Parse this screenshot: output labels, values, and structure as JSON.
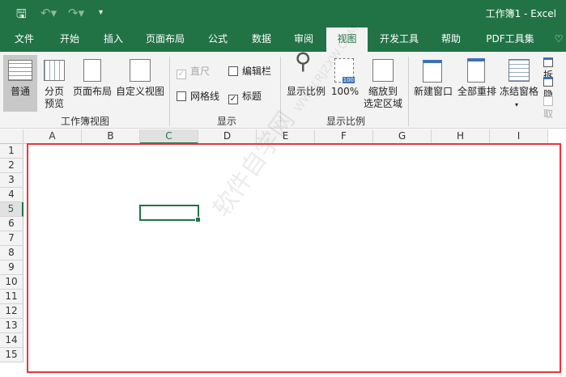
{
  "window": {
    "title": "工作簿1  -  Excel"
  },
  "tabs": [
    "文件",
    "开始",
    "插入",
    "页面布局",
    "公式",
    "数据",
    "审阅",
    "视图",
    "开发工具",
    "帮助",
    "PDF工具集"
  ],
  "active_tab": "视图",
  "ribbon": {
    "workbook_views": {
      "label": "工作簿视图",
      "buttons": [
        "普通",
        "分页\n预览",
        "页面布局",
        "自定义视图"
      ]
    },
    "show": {
      "label": "显示",
      "ruler": "直尺",
      "formula_bar": "编辑栏",
      "gridlines": "网格线",
      "headings": "标题"
    },
    "zoom": {
      "label": "显示比例",
      "buttons": [
        "显示比例",
        "100%",
        "缩放到\n选定区域"
      ],
      "badge": "100"
    },
    "window": {
      "buttons": [
        "新建窗口",
        "全部重排",
        "冻结窗格"
      ],
      "side": [
        "拆",
        "隐",
        "取"
      ]
    }
  },
  "columns": [
    "A",
    "B",
    "C",
    "D",
    "E",
    "F",
    "G",
    "H",
    "I"
  ],
  "rows": [
    "1",
    "2",
    "3",
    "4",
    "5",
    "6",
    "7",
    "8",
    "9",
    "10",
    "11",
    "12",
    "13",
    "14",
    "15"
  ],
  "selected_cell": "C5",
  "watermark": "软件自学网 WWW.RJZXW.COM"
}
